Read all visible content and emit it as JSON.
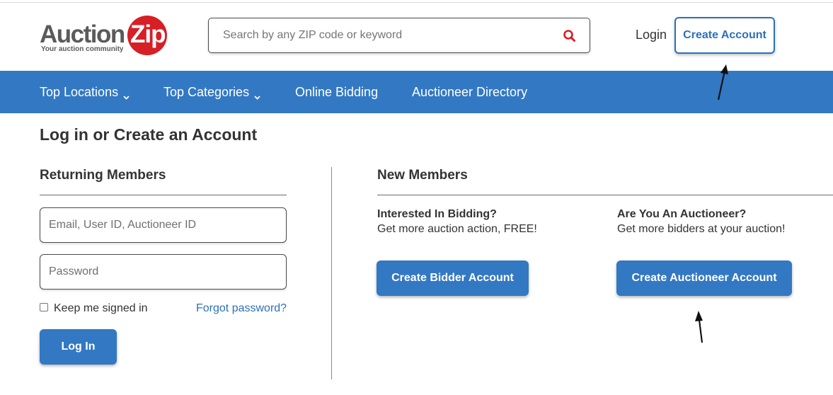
{
  "logo": {
    "word": "Auction",
    "zip": "Zip",
    "tagline": "Your auction community"
  },
  "search": {
    "placeholder": "Search by any ZIP code or keyword"
  },
  "header": {
    "login_label": "Login",
    "create_account_label": "Create Account"
  },
  "nav": {
    "items": [
      {
        "label": "Top Locations",
        "dropdown": true
      },
      {
        "label": "Top Categories",
        "dropdown": true
      },
      {
        "label": "Online Bidding",
        "dropdown": false
      },
      {
        "label": "Auctioneer Directory",
        "dropdown": false
      }
    ]
  },
  "page": {
    "title": "Log in or Create an Account"
  },
  "returning": {
    "title": "Returning Members",
    "email_placeholder": "Email, User ID, Auctioneer ID",
    "password_placeholder": "Password",
    "keep_signed_in": "Keep me signed in",
    "forgot_password": "Forgot password?",
    "login_button": "Log In"
  },
  "new_members": {
    "title": "New Members",
    "bidder": {
      "heading": "Interested In Bidding?",
      "text": "Get more auction action, FREE!",
      "button": "Create Bidder Account"
    },
    "auctioneer": {
      "heading": "Are You An Auctioneer?",
      "text": "Get more bidders at your auction!",
      "button": "Create Auctioneer Account"
    }
  },
  "colors": {
    "brand_blue": "#3378c3",
    "link_blue": "#2b71bb",
    "logo_red": "#d71f26"
  },
  "icons": {
    "search": "search-icon",
    "dropdown": "chevron-down-icon",
    "annotation": "arrow-annotation"
  }
}
